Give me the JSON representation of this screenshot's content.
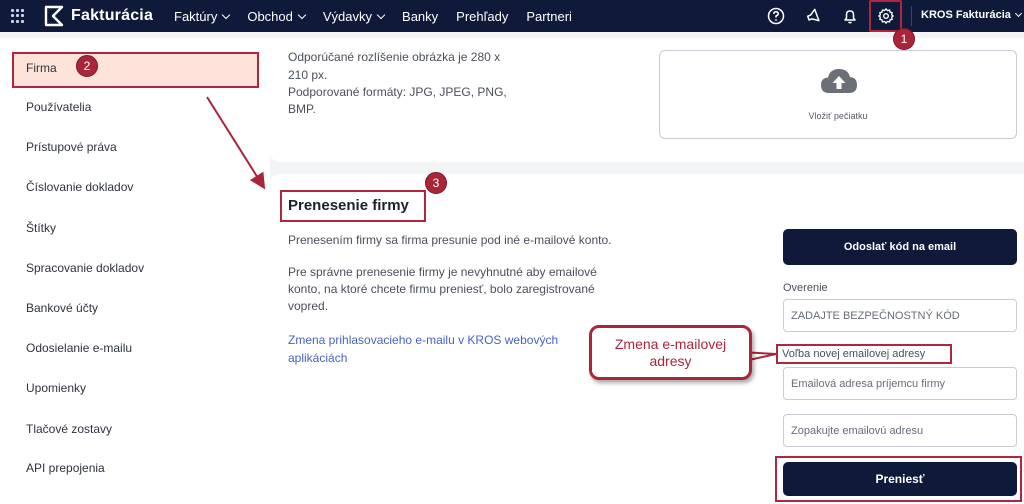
{
  "topbar": {
    "logo": "Fakturácia",
    "nav": [
      {
        "label": "Faktúry",
        "dropdown": true
      },
      {
        "label": "Obchod",
        "dropdown": true
      },
      {
        "label": "Výdavky",
        "dropdown": true
      },
      {
        "label": "Banky",
        "dropdown": false
      },
      {
        "label": "Prehľady",
        "dropdown": false
      },
      {
        "label": "Partneri",
        "dropdown": false
      }
    ],
    "icons": [
      "help-icon",
      "megaphone-icon",
      "bell-icon",
      "gear-icon"
    ],
    "user": "KROS Fakturácia"
  },
  "sidebar": {
    "items": [
      "Firma",
      "Používatelia",
      "Prístupové práva",
      "Číslovanie dokladov",
      "Štítky",
      "Spracovanie dokladov",
      "Bankové účty",
      "Odosielanie e-mailu",
      "Upomienky",
      "Tlačové zostavy",
      "API prepojenia"
    ]
  },
  "stamp": {
    "desc1": "Odporúčané rozlíšenie obrázka je 280 x",
    "desc2": "210 px.",
    "desc3": "Podporované formáty: JPG, JPEG, PNG,",
    "desc4": "BMP.",
    "upload_label": "Vložiť pečiatku"
  },
  "transfer": {
    "title": "Prenesenie firmy",
    "p1": "Prenesením firmy sa firma presunie pod iné e-mailové konto.",
    "p2a": "Pre správne prenesenie firmy je nevyhnutné aby emailové",
    "p2b": "konto, na ktoré chcete firmu preniesť, bolo zaregistrované",
    "p2c": "vopred.",
    "link1": "Zmena prihlasovacieho e-mailu v KROS webových",
    "link2": "aplikáciách",
    "send_code_button": "Odoslať kód na email",
    "verify_label": "Overenie",
    "code_placeholder": "ZADAJTE BEZPEČNOSTNÝ KÓD",
    "new_email_label": "Voľba novej emailovej adresy",
    "email_placeholder": "Emailová adresa príjemcu firmy",
    "email_repeat_placeholder": "Zopakujte emailovú adresu",
    "submit_button": "Preniesť"
  },
  "annotations": {
    "badge1": "1",
    "badge2": "2",
    "badge3": "3",
    "callout1": "Zmena e-mailovej",
    "callout2": "adresy",
    "accent_color": "#a9263a"
  }
}
